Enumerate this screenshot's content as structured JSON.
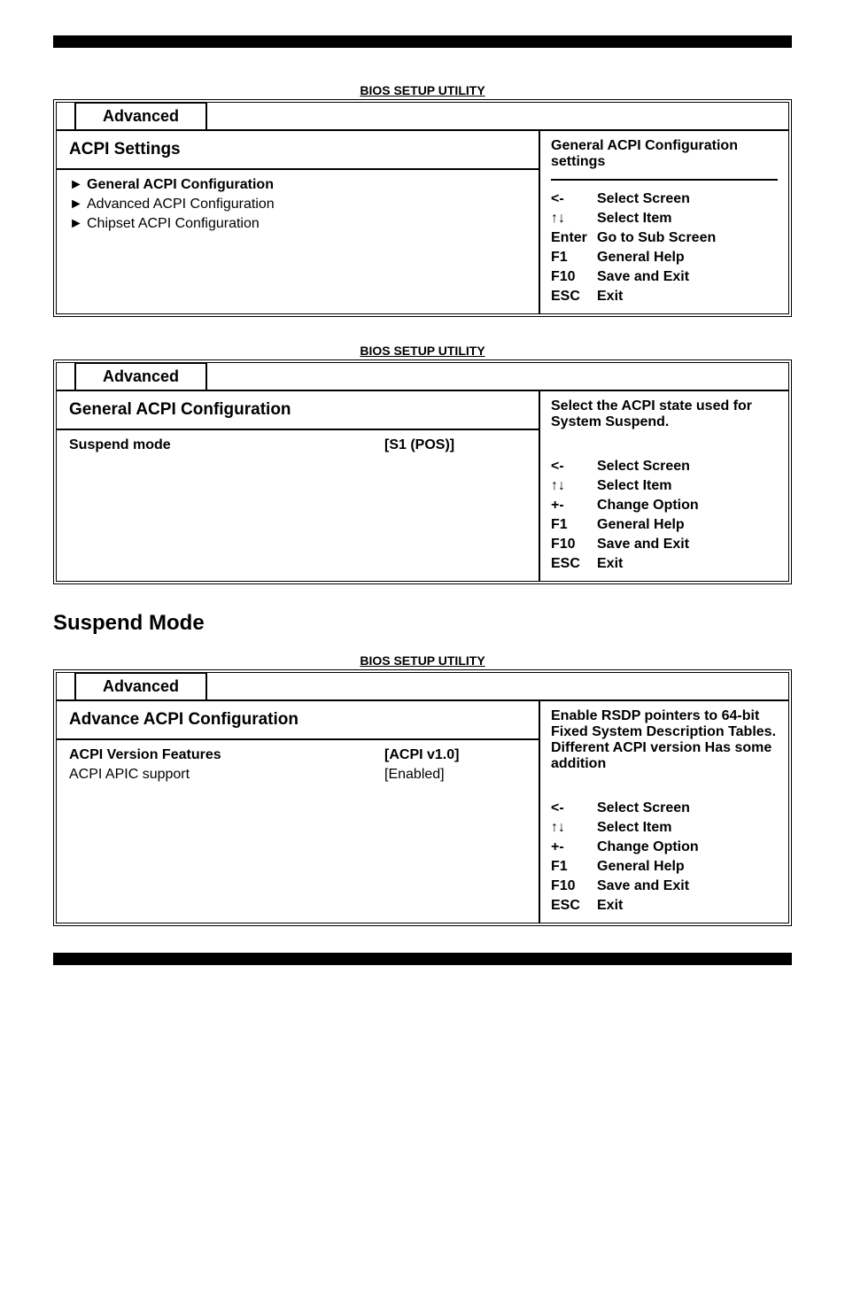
{
  "bios_title": "BIOS SETUP UTILITY",
  "tab_label": "Advanced",
  "panel1": {
    "heading": "ACPI Settings",
    "items": [
      {
        "label": "General ACPI Configuration",
        "bold": true
      },
      {
        "label": "Advanced ACPI Configuration"
      },
      {
        "label": "Chipset ACPI Configuration"
      }
    ],
    "help": "General ACPI Configuration settings",
    "keys": [
      {
        "k": "<-",
        "v": "Select Screen"
      },
      {
        "k": "↑↓",
        "v": "Select Item"
      },
      {
        "k": "Enter",
        "v": "Go to Sub Screen"
      },
      {
        "k": "F1",
        "v": "General Help"
      },
      {
        "k": "F10",
        "v": "Save and Exit"
      },
      {
        "k": "ESC",
        "v": "Exit"
      }
    ]
  },
  "panel2": {
    "heading": "General ACPI Configuration",
    "items": [
      {
        "label": "Suspend mode",
        "value": "[S1 (POS)]",
        "bold": true
      }
    ],
    "help": "Select the ACPI state used for System Suspend.",
    "keys": [
      {
        "k": "<-",
        "v": "Select Screen"
      },
      {
        "k": "↑↓",
        "v": "Select Item"
      },
      {
        "k": "+-",
        "v": "Change Option"
      },
      {
        "k": "F1",
        "v": "General Help"
      },
      {
        "k": "F10",
        "v": "Save and Exit"
      },
      {
        "k": "ESC",
        "v": "Exit"
      }
    ]
  },
  "section_header": "Suspend Mode",
  "panel3": {
    "heading": "Advance ACPI Configuration",
    "items": [
      {
        "label": "ACPI Version Features",
        "value": "[ACPI v1.0]",
        "bold": true
      },
      {
        "label": "ACPI APIC support",
        "value": "[Enabled]"
      }
    ],
    "help": "Enable RSDP pointers to 64-bit Fixed System Description Tables. Different ACPI version Has some addition",
    "keys": [
      {
        "k": "<-",
        "v": "Select Screen"
      },
      {
        "k": "↑↓",
        "v": "Select Item"
      },
      {
        "k": "+-",
        "v": "Change Option"
      },
      {
        "k": "F1",
        "v": "General Help"
      },
      {
        "k": "F10",
        "v": "Save and Exit"
      },
      {
        "k": "ESC",
        "v": "Exit"
      }
    ]
  }
}
